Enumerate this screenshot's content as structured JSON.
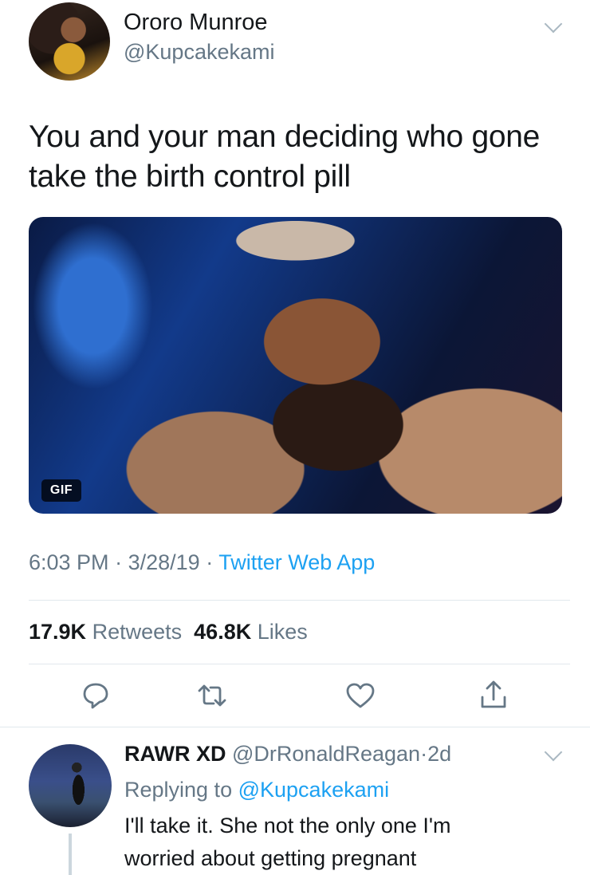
{
  "tweet": {
    "author_name": "Ororo Munroe",
    "author_handle": "@Kupcakekami",
    "text_line1": "You and your man deciding who gone",
    "text_line2": "take the birth control pill",
    "media_badge": "GIF",
    "time": "6:03 PM",
    "date": "3/28/19",
    "source": "Twitter Web App",
    "separator": "·",
    "retweet_count": "17.9K",
    "retweet_label": "Retweets",
    "like_count": "46.8K",
    "like_label": "Likes"
  },
  "actions": [
    {
      "name": "reply",
      "icon": "reply-icon"
    },
    {
      "name": "retweet",
      "icon": "retweet-icon"
    },
    {
      "name": "like",
      "icon": "heart-icon"
    },
    {
      "name": "share",
      "icon": "share-icon"
    }
  ],
  "reply": {
    "author_name": "RAWR XD",
    "author_handle": "@DrRonaldReagan",
    "separator": "·",
    "age": "2d",
    "replying_prefix": "Replying to",
    "replying_to": "@Kupcakekami",
    "text_line1": "I'll take it. She not the only one I'm",
    "text_line2": "worried about getting pregnant"
  },
  "colors": {
    "accent": "#1da1f2",
    "text_primary": "#14171a",
    "text_secondary": "#657786",
    "divider": "#e1e8ed",
    "icon": "#657786"
  }
}
